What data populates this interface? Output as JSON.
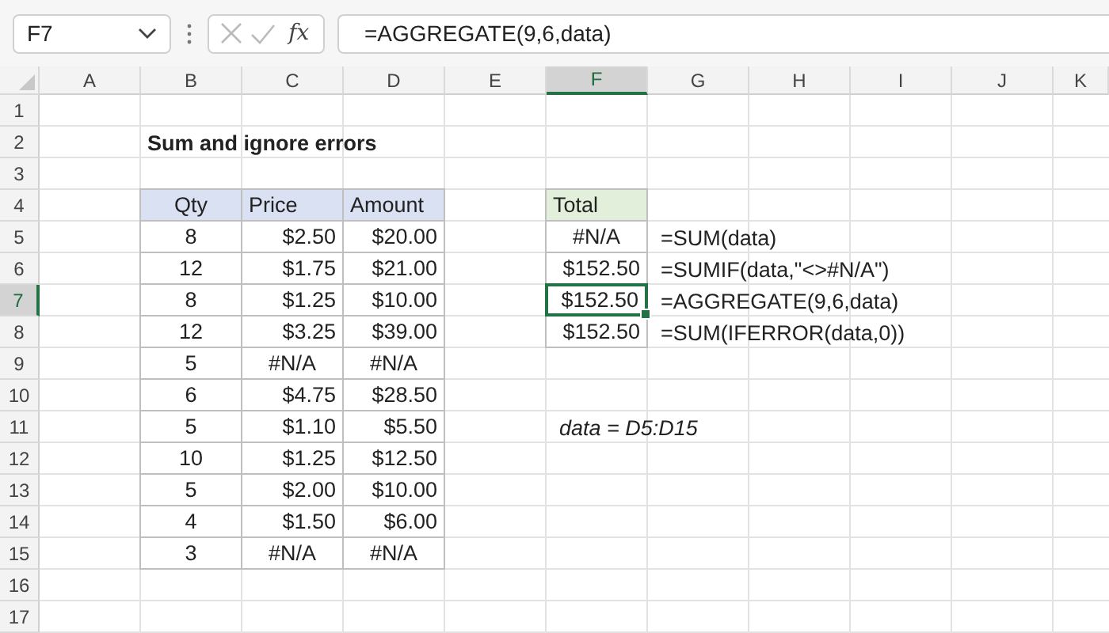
{
  "name_box": "F7",
  "fx_button": "fx",
  "formula": "=AGGREGATE(9,6,data)",
  "column_headers": [
    {
      "label": "A",
      "selected": false
    },
    {
      "label": "B",
      "selected": false
    },
    {
      "label": "C",
      "selected": false
    },
    {
      "label": "D",
      "selected": false
    },
    {
      "label": "E",
      "selected": false
    },
    {
      "label": "F",
      "selected": true
    },
    {
      "label": "G",
      "selected": false
    },
    {
      "label": "H",
      "selected": false
    },
    {
      "label": "I",
      "selected": false
    },
    {
      "label": "J",
      "selected": false
    },
    {
      "label": "K",
      "selected": false
    }
  ],
  "row_headers": [
    {
      "label": "1",
      "selected": false
    },
    {
      "label": "2",
      "selected": false
    },
    {
      "label": "3",
      "selected": false
    },
    {
      "label": "4",
      "selected": false
    },
    {
      "label": "5",
      "selected": false
    },
    {
      "label": "6",
      "selected": false
    },
    {
      "label": "7",
      "selected": true
    },
    {
      "label": "8",
      "selected": false
    },
    {
      "label": "9",
      "selected": false
    },
    {
      "label": "10",
      "selected": false
    },
    {
      "label": "11",
      "selected": false
    },
    {
      "label": "12",
      "selected": false
    },
    {
      "label": "13",
      "selected": false
    },
    {
      "label": "14",
      "selected": false
    },
    {
      "label": "15",
      "selected": false
    },
    {
      "label": "16",
      "selected": false
    },
    {
      "label": "17",
      "selected": false
    }
  ],
  "title": "Sum and ignore errors",
  "table": {
    "columns": [
      "Qty",
      "Price",
      "Amount"
    ],
    "rows": [
      {
        "qty": "8",
        "price": "$2.50",
        "amount": "$20.00",
        "error": false
      },
      {
        "qty": "12",
        "price": "$1.75",
        "amount": "$21.00",
        "error": false
      },
      {
        "qty": "8",
        "price": "$1.25",
        "amount": "$10.00",
        "error": false
      },
      {
        "qty": "12",
        "price": "$3.25",
        "amount": "$39.00",
        "error": false
      },
      {
        "qty": "5",
        "price": "#N/A",
        "amount": "#N/A",
        "error": true
      },
      {
        "qty": "6",
        "price": "$4.75",
        "amount": "$28.50",
        "error": false
      },
      {
        "qty": "5",
        "price": "$1.10",
        "amount": "$5.50",
        "error": false
      },
      {
        "qty": "10",
        "price": "$1.25",
        "amount": "$12.50",
        "error": false
      },
      {
        "qty": "5",
        "price": "$2.00",
        "amount": "$10.00",
        "error": false
      },
      {
        "qty": "4",
        "price": "$1.50",
        "amount": "$6.00",
        "error": false
      },
      {
        "qty": "3",
        "price": "#N/A",
        "amount": "#N/A",
        "error": true
      }
    ]
  },
  "total": {
    "header": "Total",
    "rows": [
      {
        "value": "#N/A",
        "formula": "=SUM(data)",
        "error": true,
        "selected": false
      },
      {
        "value": "$152.50",
        "formula": "=SUMIF(data,\"<>#N/A\")",
        "error": false,
        "selected": false
      },
      {
        "value": "$152.50",
        "formula": "=AGGREGATE(9,6,data)",
        "error": false,
        "selected": true
      },
      {
        "value": "$152.50",
        "formula": "=SUM(IFERROR(data,0))",
        "error": false,
        "selected": false
      }
    ]
  },
  "note": "data = D5:D15"
}
